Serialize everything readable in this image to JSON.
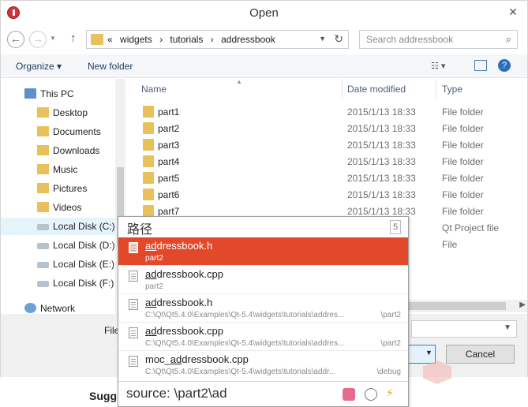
{
  "window": {
    "title": "Open",
    "close_label": "✕"
  },
  "nav": {
    "back": "←",
    "forward": "→",
    "up": "↑",
    "address": [
      "«",
      "widgets",
      "›",
      "tutorials",
      "›",
      "addressbook"
    ],
    "search_placeholder": "Search addressbook"
  },
  "toolbar": {
    "organize": "Organize ▾",
    "new_folder": "New folder",
    "help": "?"
  },
  "sidebar": {
    "items": [
      {
        "label": "This PC",
        "icon": "pc-icon"
      },
      {
        "label": "Desktop",
        "icon": "folder-icon"
      },
      {
        "label": "Documents",
        "icon": "folder-icon"
      },
      {
        "label": "Downloads",
        "icon": "folder-icon"
      },
      {
        "label": "Music",
        "icon": "folder-icon"
      },
      {
        "label": "Pictures",
        "icon": "folder-icon"
      },
      {
        "label": "Videos",
        "icon": "folder-icon"
      },
      {
        "label": "Local Disk (C:)",
        "icon": "drive-icon"
      },
      {
        "label": "Local Disk (D:)",
        "icon": "drive-icon"
      },
      {
        "label": "Local Disk (E:)",
        "icon": "drive-icon"
      },
      {
        "label": "Local Disk (F:)",
        "icon": "drive-icon"
      },
      {
        "label": "Network",
        "icon": "network-icon"
      }
    ]
  },
  "files": {
    "columns": {
      "name": "Name",
      "date": "Date modified",
      "type": "Type"
    },
    "rows": [
      {
        "name": "part1",
        "date": "2015/1/13 18:33",
        "type": "File folder"
      },
      {
        "name": "part2",
        "date": "2015/1/13 18:33",
        "type": "File folder"
      },
      {
        "name": "part3",
        "date": "2015/1/13 18:33",
        "type": "File folder"
      },
      {
        "name": "part4",
        "date": "2015/1/13 18:33",
        "type": "File folder"
      },
      {
        "name": "part5",
        "date": "2015/1/13 18:33",
        "type": "File folder"
      },
      {
        "name": "part6",
        "date": "2015/1/13 18:33",
        "type": "File folder"
      },
      {
        "name": "part7",
        "date": "2015/1/13 18:33",
        "type": "File folder"
      }
    ],
    "extra_types": [
      "Qt Project file",
      "File"
    ]
  },
  "bottom": {
    "file_label": "File",
    "cancel": "Cancel"
  },
  "popup": {
    "title": "路径",
    "count": "5",
    "candidates": [
      {
        "match": "ad",
        "rest": "dressbook.h",
        "path": "part2",
        "path_right": ""
      },
      {
        "match": "ad",
        "rest": "dressbook.cpp",
        "path": "part2",
        "path_right": ""
      },
      {
        "match": "ad",
        "rest": "dressbook.h",
        "path": "C:\\Qt\\Qt5.4.0\\Examples\\Qt-5.4\\widgets\\tutorials\\addres...",
        "path_right": "\\part2"
      },
      {
        "match": "ad",
        "rest": "dressbook.cpp",
        "path": "C:\\Qt\\Qt5.4.0\\Examples\\Qt-5.4\\widgets\\tutorials\\addres...",
        "path_right": "\\part2"
      },
      {
        "prefix": "moc_",
        "match": "ad",
        "rest": "dressbook.cpp",
        "path": "C:\\Qt\\Qt5.4.0\\Examples\\Qt-5.4\\widgets\\tutorials\\addr...",
        "path_right": "\\debug"
      }
    ],
    "source": "source: \\part2\\ad"
  },
  "page": {
    "below_text": "Sugg"
  }
}
